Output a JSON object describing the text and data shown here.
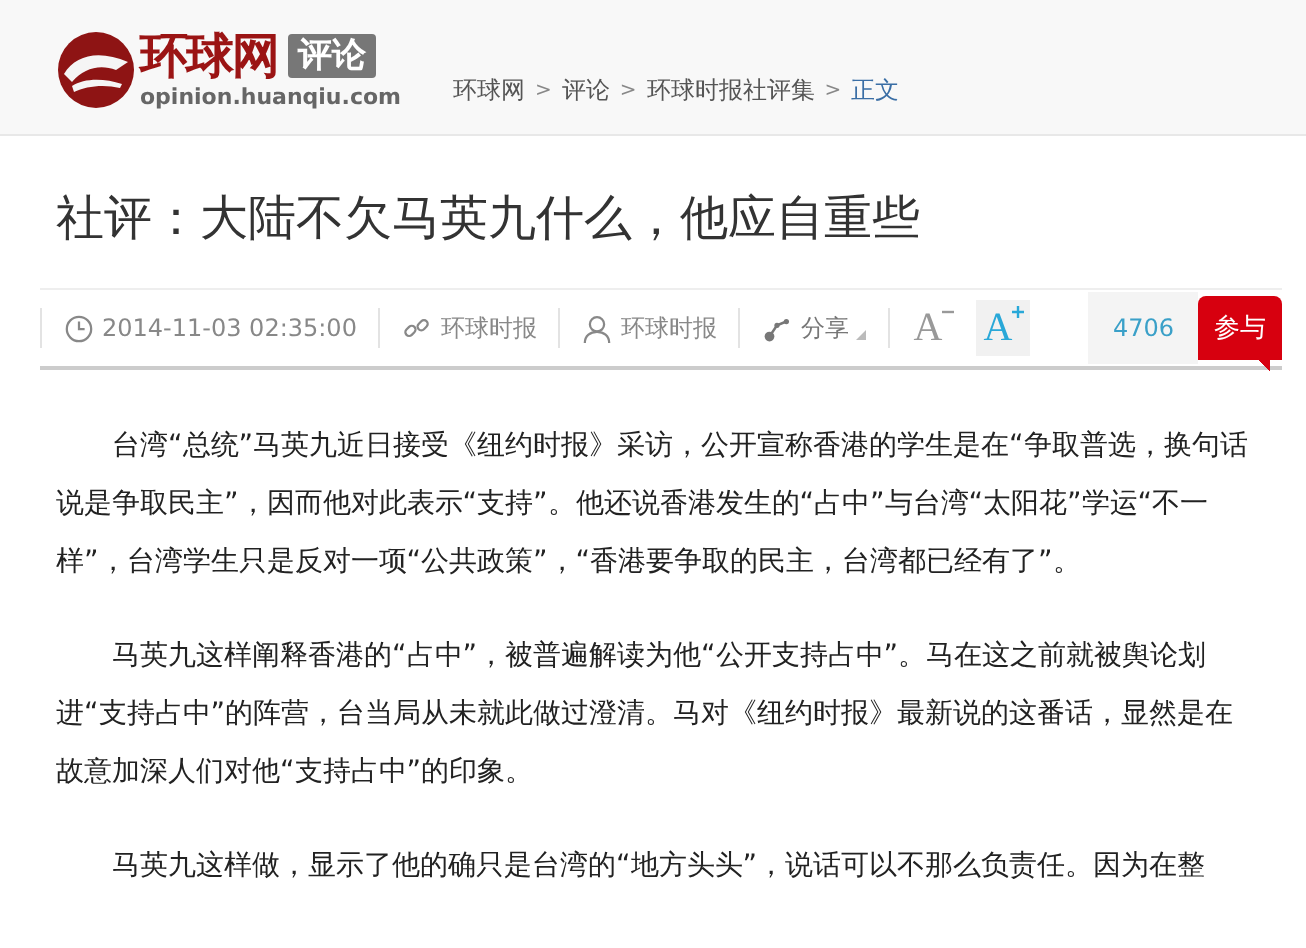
{
  "header": {
    "logo": {
      "name": "环球网",
      "section": "评论",
      "domain": "opinion.huanqiu.com"
    },
    "breadcrumb": {
      "separator": ">",
      "items": [
        {
          "label": "环球网",
          "current": false
        },
        {
          "label": "评论",
          "current": false
        },
        {
          "label": "环球时报社评集",
          "current": false
        },
        {
          "label": "正文",
          "current": true
        }
      ]
    }
  },
  "article": {
    "title": "社评：大陆不欠马英九什么，他应自重些",
    "meta": [
      {
        "kind": "time",
        "text": "2014-11-03 02:35:00"
      },
      {
        "kind": "source",
        "text": "环球时报"
      },
      {
        "kind": "author",
        "text": "环球时报"
      },
      {
        "kind": "share",
        "text": "分享"
      }
    ],
    "font_buttons": [
      {
        "kind": "smaller",
        "label": "A",
        "selected": false
      },
      {
        "kind": "larger",
        "label": "A",
        "selected": true
      }
    ],
    "comment_count": "4706",
    "join_button": "参与",
    "paragraphs": [
      "台湾“总统”马英九近日接受《纽约时报》采访，公开宣称香港的学生是在“争取普选，换句话说是争取民主”，因而他对此表示“支持”。他还说香港发生的“占中”与台湾“太阳花”学运“不一样”，台湾学生只是反对一项“公共政策”，“香港要争取的民主，台湾都已经有了”。",
      "马英九这样阐释香港的“占中”，被普遍解读为他“公开支持占中”。马在这之前就被舆论划进“支持占中”的阵营，台当局从未就此做过澄清。马对《纽约时报》最新说的这番话，显然是在故意加深人们对他“支持占中”的印象。",
      "马英九这样做，显示了他的确只是台湾的“地方头头”，说话可以不那么负责任。因为在整"
    ]
  }
}
